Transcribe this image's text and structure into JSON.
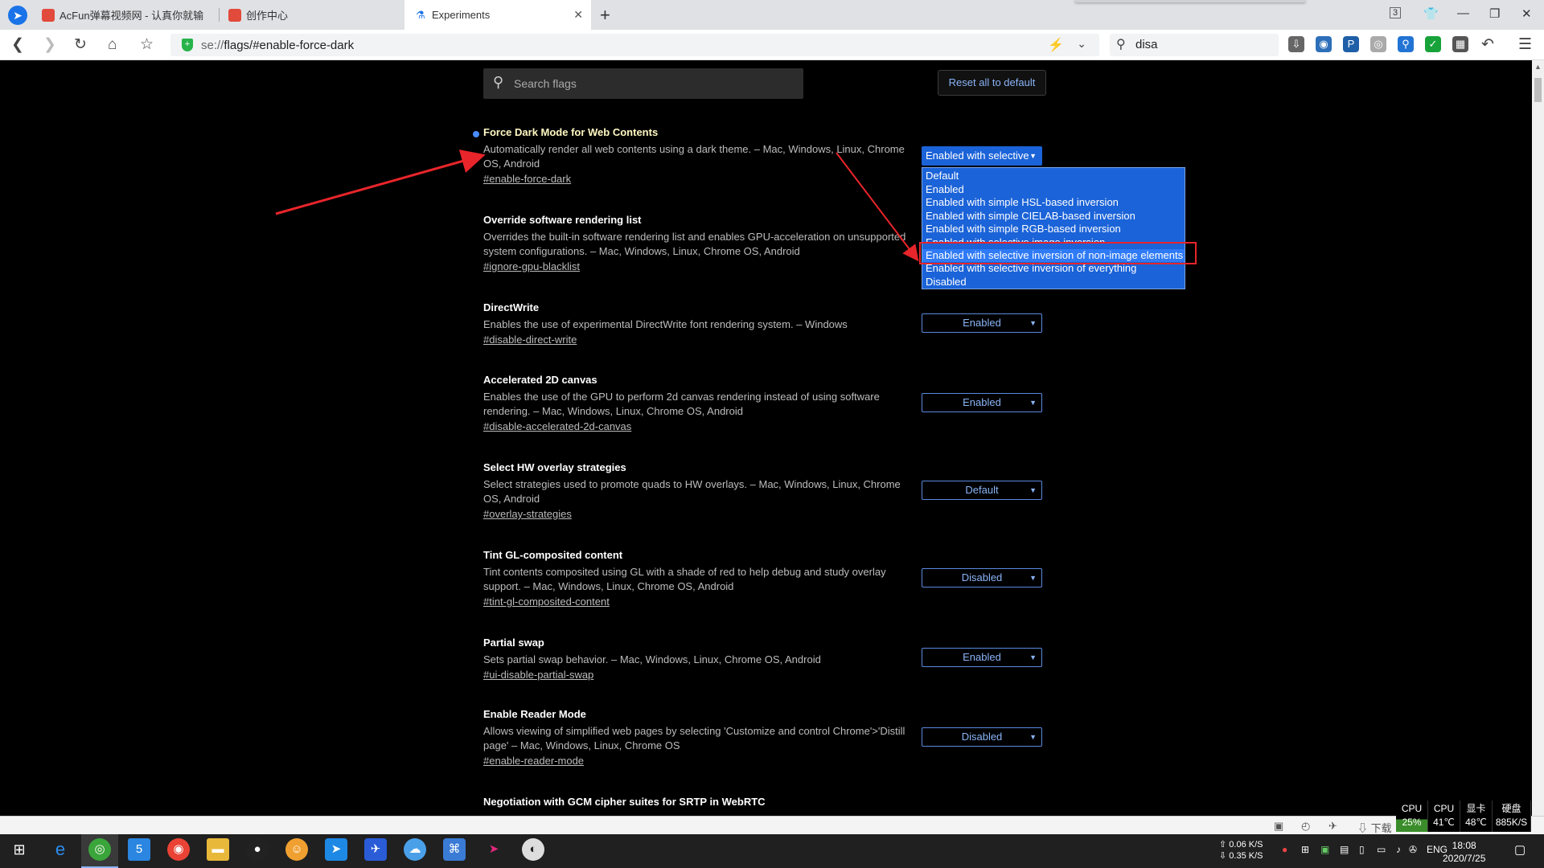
{
  "tabs": [
    {
      "label": "AcFun弹幕视频网 - 认真你就输"
    },
    {
      "label": "创作中心"
    },
    {
      "label": "Experiments"
    }
  ],
  "tab_counter": "3",
  "omnibox": {
    "prefix": "se://",
    "path": "flags/#enable-force-dark"
  },
  "search_box": {
    "value": "disa"
  },
  "flags_search": {
    "placeholder": "Search flags"
  },
  "reset_button": "Reset all to default",
  "flags": [
    {
      "title": "Force Dark Mode for Web Contents",
      "desc": "Automatically render all web contents using a dark theme. – Mac, Windows, Linux, Chrome OS, Android",
      "link": "#enable-force-dark",
      "value": "Enabled with selective"
    },
    {
      "title": "Override software rendering list",
      "desc": "Overrides the built-in software rendering list and enables GPU-acceleration on unsupported system configurations. – Mac, Windows, Linux, Chrome OS, Android",
      "link": "#ignore-gpu-blacklist",
      "value": ""
    },
    {
      "title": "DirectWrite",
      "desc": "Enables the use of experimental DirectWrite font rendering system. – Windows",
      "link": "#disable-direct-write",
      "value": "Enabled"
    },
    {
      "title": "Accelerated 2D canvas",
      "desc": "Enables the use of the GPU to perform 2d canvas rendering instead of using software rendering. – Mac, Windows, Linux, Chrome OS, Android",
      "link": "#disable-accelerated-2d-canvas",
      "value": "Enabled"
    },
    {
      "title": "Select HW overlay strategies",
      "desc": "Select strategies used to promote quads to HW overlays. – Mac, Windows, Linux, Chrome OS, Android",
      "link": "#overlay-strategies",
      "value": "Default"
    },
    {
      "title": "Tint GL-composited content",
      "desc": "Tint contents composited using GL with a shade of red to help debug and study overlay support. – Mac, Windows, Linux, Chrome OS, Android",
      "link": "#tint-gl-composited-content",
      "value": "Disabled"
    },
    {
      "title": "Partial swap",
      "desc": "Sets partial swap behavior. – Mac, Windows, Linux, Chrome OS, Android",
      "link": "#ui-disable-partial-swap",
      "value": "Enabled"
    },
    {
      "title": "Enable Reader Mode",
      "desc": "Allows viewing of simplified web pages by selecting 'Customize and control Chrome'>'Distill page' – Mac, Windows, Linux, Chrome OS",
      "link": "#enable-reader-mode",
      "value": "Disabled"
    },
    {
      "title": "Negotiation with GCM cipher suites for SRTP in WebRTC",
      "desc": "",
      "link": "",
      "value": ""
    }
  ],
  "dropdown_options": [
    "Default",
    "Enabled",
    "Enabled with simple HSL-based inversion",
    "Enabled with simple CIELAB-based inversion",
    "Enabled with simple RGB-based inversion",
    "Enabled with selective image inversion",
    "Enabled with selective inversion of non-image elements",
    "Enabled with selective inversion of everything",
    "Disabled"
  ],
  "statusbar": {
    "download_label": "下载"
  },
  "monitor": [
    {
      "label": "CPU",
      "value": "25%"
    },
    {
      "label": "CPU",
      "value": "41℃"
    },
    {
      "label": "显卡",
      "value": "48℃"
    },
    {
      "label": "硬盘",
      "value": "885K/S"
    }
  ],
  "taskbar": {
    "net_up": "0.06 K/S",
    "net_down": "0.35 K/S",
    "lang": "ENG",
    "time": "18:08",
    "date": "2020/7/25"
  },
  "colors": {
    "accent": "#8ab4f8",
    "selected": "#1b63d8",
    "annotation": "#e8252a"
  }
}
